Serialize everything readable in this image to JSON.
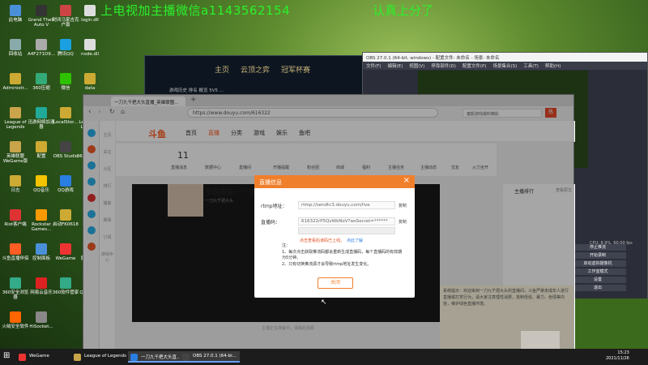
{
  "banner": {
    "left": "上电视加主播微信a1143562154",
    "right": "认真上分了"
  },
  "desktop_icons": [
    {
      "label": "此电脑",
      "color": "#4a90d9"
    },
    {
      "label": "Grand Theft Auto V",
      "color": "#333"
    },
    {
      "label": "封闭马家吉克 户篇",
      "color": "#cc4444"
    },
    {
      "label": "login.dll",
      "color": "#ddd"
    },
    {
      "label": "回收站",
      "color": "#8aa"
    },
    {
      "label": "A4F271D9...",
      "color": "#aaa"
    },
    {
      "label": "腾讯QQ",
      "color": "#1aa0e0"
    },
    {
      "label": "node.dll",
      "color": "#ddd"
    },
    {
      "label": "Administr...",
      "color": "#ccaa33"
    },
    {
      "label": "360压缩",
      "color": "#3a7"
    },
    {
      "label": "微信",
      "color": "#2dc100"
    },
    {
      "label": "data",
      "color": "#ccaa33"
    },
    {
      "label": "League of Legends",
      "color": "#c9a44a"
    },
    {
      "label": "迅游网络加速器",
      "color": "#2a9"
    },
    {
      "label": "LocalStor...",
      "color": "#ccaa33"
    },
    {
      "label": "League of Legends",
      "color": "#c9a44a"
    },
    {
      "label": "英雄联盟 WeGame版",
      "color": "#c9a44a"
    },
    {
      "label": "配置",
      "color": "#ccaa33"
    },
    {
      "label": "OBS Studio",
      "color": "#444"
    },
    {
      "label": "360安全卫士",
      "color": "#3a8"
    },
    {
      "label": "日志",
      "color": "#ccaa33"
    },
    {
      "label": "QQ音乐",
      "color": "#f5c400"
    },
    {
      "label": "QQ游戏",
      "color": "#2a7de1"
    },
    {
      "label": "进程",
      "color": "#ccaa33"
    },
    {
      "label": "Riot客户端",
      "color": "#d33"
    },
    {
      "label": "Rockstar Games...",
      "color": "#f90"
    },
    {
      "label": "启动FK0618",
      "color": "#ccaa33"
    },
    {
      "label": "Steam",
      "color": "#234"
    },
    {
      "label": "斗鱼直播伴侣",
      "color": "#ff5d23"
    },
    {
      "label": "控制面板",
      "color": "#4a90d9"
    },
    {
      "label": "WeGame",
      "color": "#e33"
    },
    {
      "label": "腾讯视频",
      "color": "#2a7de1"
    },
    {
      "label": "360安全浏览器",
      "color": "#3a8"
    },
    {
      "label": "网易云音乐",
      "color": "#d22"
    },
    {
      "label": "360软件管家",
      "color": "#3a8"
    },
    {
      "label": "QQ浏览器",
      "color": "#2a7de1"
    },
    {
      "label": "火绒安全软件",
      "color": "#f60"
    },
    {
      "label": "HiSocket...",
      "color": "#888"
    }
  ],
  "game_client": {
    "tabs": [
      "主页",
      "云顶之弈",
      "冠军杯赛"
    ],
    "sub": "游戏历史  排名  概览  5V5 ..."
  },
  "obs": {
    "title": "OBS 27.0.1 (64-bit, windows) - 配置文件: 未命名 - 场景: 未命名",
    "menu": [
      "文件(F)",
      "编辑(E)",
      "视图(V)",
      "停靠部件(D)",
      "配置文件(P)",
      "场景集合(S)",
      "工具(T)",
      "帮助(H)"
    ],
    "buttons": [
      "停止推流",
      "开始录制",
      "启动虚拟摄像机",
      "工作室模式",
      "设置",
      "退出"
    ],
    "status": "CPU: 8.9%, 60.00 fps"
  },
  "browser": {
    "tab_title": "一刀九千把大头直播_英雄联盟...",
    "url": "https://www.douyu.com/616322",
    "search_placeholder": "童颜游戏爆料精彩",
    "hot_badge": "热"
  },
  "douyu": {
    "logo": "斗鱼",
    "nav": [
      "首页",
      "直播",
      "分类",
      "游戏",
      "娱乐",
      "鱼吧"
    ],
    "left_items": [
      "主页",
      "关注",
      "分区",
      "排行",
      "播客",
      "赛事",
      "订阅",
      "游戏中心"
    ],
    "toolbar": [
      "直播消息",
      "数据中心",
      "直播间",
      "开播提醒",
      "粉丝团",
      "商城",
      "福利",
      "主播任务",
      "主播动态",
      "交友",
      "火力全开"
    ],
    "fan_count": "11",
    "title": "季前赛第一个王",
    "subtitle": "一刀九千把大头",
    "right_header": "主播排行",
    "right_header_link": "查看原文",
    "bottom_text": "主播正在准备中，请稍后观看",
    "chat_text": "系统提示：欢迎来到一刀九千把大头的直播间，斗鱼严禁未成年人进行直播或打赏行为，请大家注意理性消费，抵制低俗、暴力、色情等内容，维护绿色直播环境。"
  },
  "modal": {
    "title": "直播信息",
    "close": "×",
    "rtmp_label": "rtmp地址：",
    "rtmp_value": "rtmp://sendtc3.douyu.com/live",
    "code_label": "直播码：",
    "code_value": "616322rP5QvWkNoV?wsSecret=******",
    "copy": "复制",
    "hint": "点击查看后该码已上线，",
    "hint_link": "点此了解",
    "note_title": "注：",
    "note1": "1、每次点击获取推流码都会重新生成直播码，每个直播码的有效期为5分钟。",
    "note2": "2、只有切换推流源才会导致rtmp地址发生变化。",
    "button": "关闭"
  },
  "taskbar": {
    "items": [
      {
        "label": "WeGame",
        "color": "#e33"
      },
      {
        "label": "League of Legends",
        "color": "#c9a44a"
      },
      {
        "label": "一刀九千把大头直...",
        "color": "#2a7de1"
      },
      {
        "label": "OBS 27.0.1 (64-bi...",
        "color": "#444"
      }
    ],
    "time": "15:23",
    "date": "2021/11/26"
  }
}
